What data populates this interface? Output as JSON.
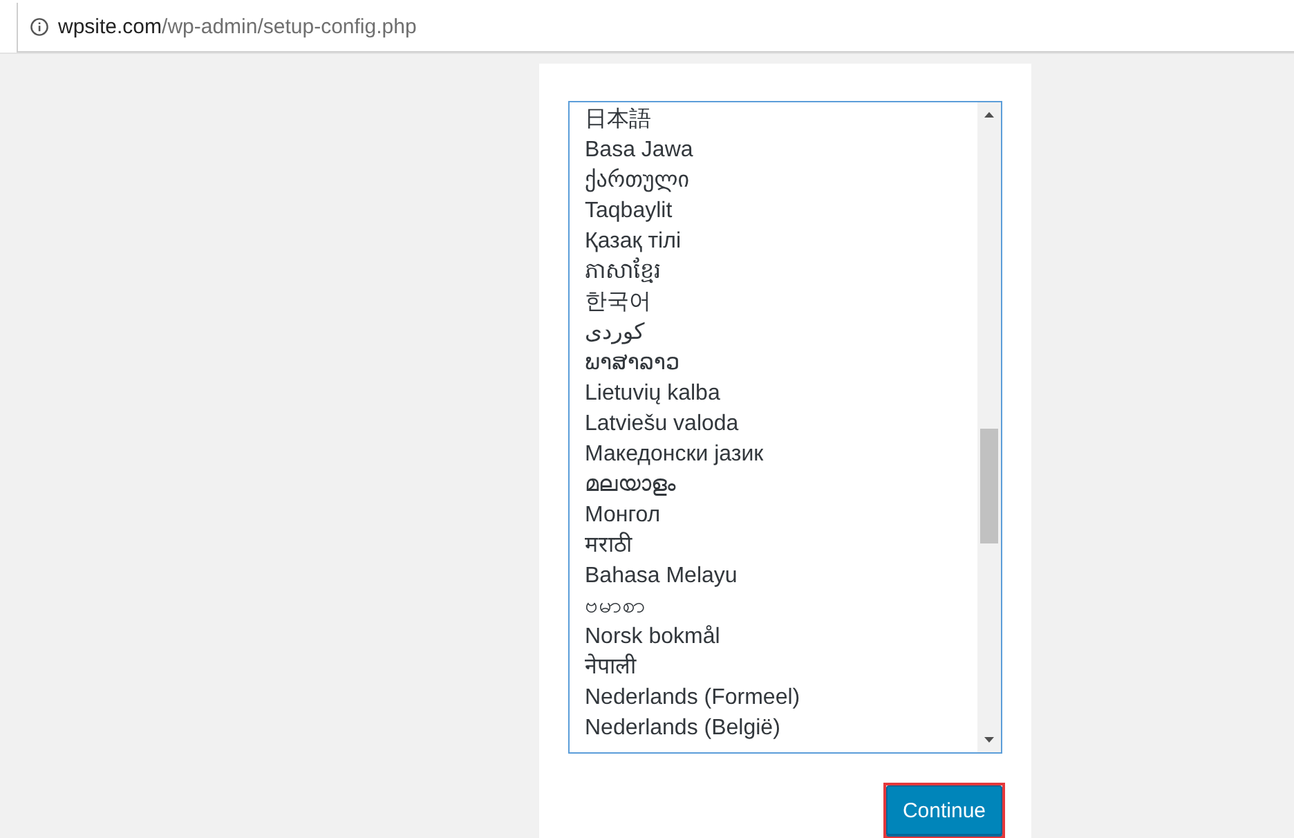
{
  "address_bar": {
    "host": "wpsite.com",
    "path": "/wp-admin/setup-config.php"
  },
  "language_list": {
    "items": [
      "日本語",
      "Basa Jawa",
      "ქართული",
      "Taqbaylit",
      "Қазақ тілі",
      "ភាសាខ្មែរ",
      "한국어",
      "كوردی",
      "ພາສາລາວ",
      "Lietuvių kalba",
      "Latviešu valoda",
      "Македонски јазик",
      "മലയാളം",
      "Монгол",
      "मराठी",
      "Bahasa Melayu",
      "ဗမာစာ",
      "Norsk bokmål",
      "नेपाली",
      "Nederlands (Formeel)",
      "Nederlands (België)"
    ]
  },
  "continue_button": {
    "label": "Continue",
    "highlighted": true
  }
}
